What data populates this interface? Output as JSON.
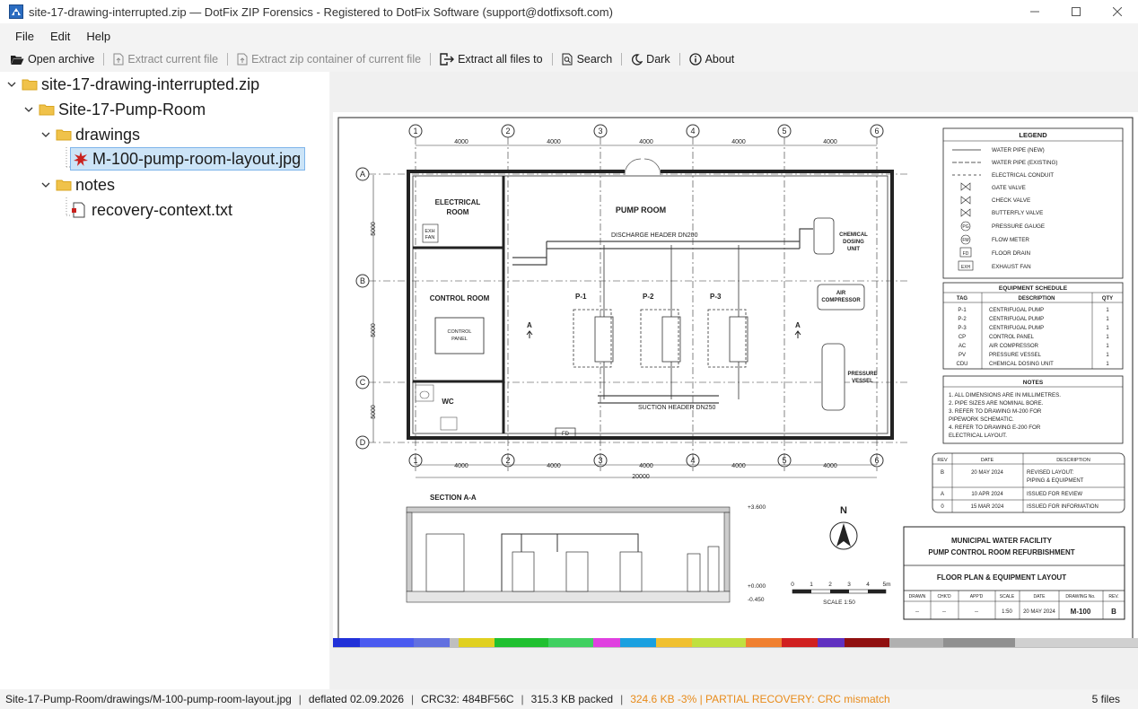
{
  "window": {
    "title": "site-17-drawing-interrupted.zip — DotFix ZIP Forensics - Registered to DotFix Software (support@dotfixsoft.com)"
  },
  "menu": [
    "File",
    "Edit",
    "Help"
  ],
  "toolbar": {
    "open_archive": "Open archive",
    "extract_current": "Extract current file",
    "extract_container": "Extract zip container of current file",
    "extract_all": "Extract all files to",
    "search": "Search",
    "dark": "Dark",
    "about": "About"
  },
  "tree": {
    "root": "site-17-drawing-interrupted.zip",
    "folder1": "Site-17-Pump-Room",
    "folder2": "drawings",
    "file1": "M-100-pump-room-layout.jpg",
    "folder3": "notes",
    "file2": "recovery-context.txt"
  },
  "drawing": {
    "grid_cols": [
      "1",
      "2",
      "3",
      "4",
      "5",
      "6"
    ],
    "grid_rows": [
      "A",
      "B",
      "C",
      "D"
    ],
    "dim_4000": "4000",
    "dim_5000": "5000",
    "dim_total": "20000",
    "rooms": {
      "electrical": "ELECTRICAL",
      "electrical2": "ROOM",
      "exh": "EXH",
      "fan": "FAN",
      "control": "CONTROL ROOM",
      "control_panel": "CONTROL",
      "control_panel2": "PANEL",
      "wc": "WC",
      "pump_room": "PUMP ROOM",
      "fd": "FD"
    },
    "labels": {
      "discharge": "DISCHARGE HEADER DN200",
      "suction": "SUCTION HEADER DN250",
      "p1": "P-1",
      "p2": "P-2",
      "p3": "P-3",
      "sec_a": "A",
      "chem1": "CHEMICAL",
      "chem2": "DOSING",
      "chem3": "UNIT",
      "air1": "AIR",
      "air2": "COMPRESSOR",
      "pv1": "PRESSURE",
      "pv2": "VESSEL"
    },
    "legend": {
      "title": "LEGEND",
      "items": [
        "WATER PIPE (NEW)",
        "WATER PIPE (EXISTING)",
        "ELECTRICAL CONDUIT",
        "GATE VALVE",
        "CHECK VALVE",
        "BUTTERFLY VALVE",
        "PRESSURE GAUGE",
        "FLOW METER",
        "FLOOR DRAIN",
        "EXHAUST FAN"
      ],
      "symbols": [
        "PG",
        "FM",
        "FD",
        "EXH"
      ]
    },
    "schedule": {
      "title": "EQUIPMENT SCHEDULE",
      "headers": [
        "TAG",
        "DESCRIPTION",
        "QTY"
      ],
      "rows": [
        [
          "P-1",
          "CENTRIFUGAL PUMP",
          "1"
        ],
        [
          "P-2",
          "CENTRIFUGAL PUMP",
          "1"
        ],
        [
          "P-3",
          "CENTRIFUGAL PUMP",
          "1"
        ],
        [
          "CP",
          "CONTROL PANEL",
          "1"
        ],
        [
          "AC",
          "AIR COMPRESSOR",
          "1"
        ],
        [
          "PV",
          "PRESSURE VESSEL",
          "1"
        ],
        [
          "CDU",
          "CHEMICAL DOSING UNIT",
          "1"
        ]
      ]
    },
    "notes": {
      "title": "NOTES",
      "lines": [
        "1.  ALL DIMENSIONS ARE IN MILLIMETRES.",
        "2.  PIPE SIZES ARE NOMINAL BORE.",
        "3.  REFER TO DRAWING M-200 FOR",
        "     PIPEWORK SCHEMATIC.",
        "4.  REFER TO DRAWING E-200 FOR",
        "     ELECTRICAL LAYOUT."
      ]
    },
    "revisions": {
      "headers": [
        "REV",
        "DATE",
        "DESCRIPTION"
      ],
      "rows": [
        [
          "B",
          "20 MAY 2024",
          "REVISED LAYOUT:",
          "PIPING & EQUIPMENT"
        ],
        [
          "A",
          "10 APR 2024",
          "ISSUED FOR REVIEW",
          ""
        ],
        [
          "0",
          "15 MAR 2024",
          "ISSUED FOR INFORMATION",
          ""
        ]
      ]
    },
    "section": {
      "title": "SECTION A-A",
      "level_top": "+3.600",
      "level_floor": "+0.000",
      "level_bottom": "-0.450"
    },
    "north": "N",
    "scale": {
      "ticks": [
        "0",
        "1",
        "2",
        "3",
        "4",
        "5m"
      ],
      "label": "SCALE 1:50"
    },
    "titleblock": {
      "line1": "MUNICIPAL WATER FACILITY",
      "line2": "PUMP CONTROL ROOM REFURBISHMENT",
      "line3": "FLOOR PLAN & EQUIPMENT LAYOUT",
      "headers": [
        "DRAWN",
        "CHK'D",
        "APP'D",
        "SCALE",
        "DATE",
        "DRAWING No.",
        "REV."
      ],
      "values": [
        "--",
        "--",
        "--",
        "1:50",
        "20 MAY 2024",
        "M-100",
        "B"
      ]
    }
  },
  "status": {
    "path": "Site-17-Pump-Room/drawings/M-100-pump-room-layout.jpg",
    "method": "deflated  02.09.2026",
    "crc": "CRC32: 484BF56C",
    "packed": "315.3 KB packed",
    "warning": "324.6 KB  -3%  |  PARTIAL RECOVERY: CRC mismatch",
    "count": "5 files"
  },
  "colors": {
    "selection": "#cce4f7",
    "warning": "#e88b1a"
  }
}
